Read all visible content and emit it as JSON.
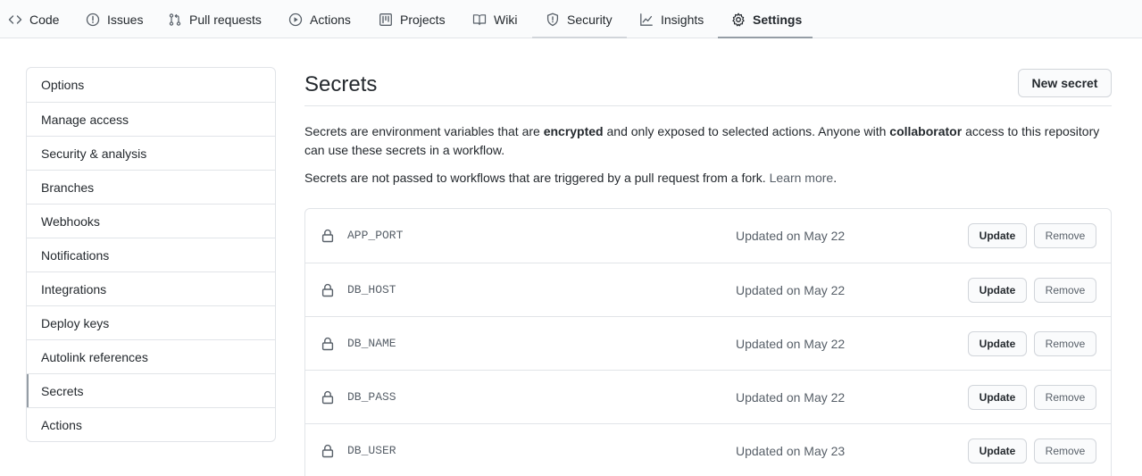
{
  "repo_nav": {
    "tabs": [
      {
        "label": "Code",
        "icon": "code-icon"
      },
      {
        "label": "Issues",
        "icon": "issue-opened-icon"
      },
      {
        "label": "Pull requests",
        "icon": "git-pull-request-icon"
      },
      {
        "label": "Actions",
        "icon": "play-icon"
      },
      {
        "label": "Projects",
        "icon": "project-icon"
      },
      {
        "label": "Wiki",
        "icon": "book-icon"
      },
      {
        "label": "Security",
        "icon": "shield-icon"
      },
      {
        "label": "Insights",
        "icon": "graph-icon"
      },
      {
        "label": "Settings",
        "icon": "gear-icon"
      }
    ],
    "selected": "Settings"
  },
  "sidebar": {
    "items": [
      {
        "label": "Options"
      },
      {
        "label": "Manage access"
      },
      {
        "label": "Security & analysis"
      },
      {
        "label": "Branches"
      },
      {
        "label": "Webhooks"
      },
      {
        "label": "Notifications"
      },
      {
        "label": "Integrations"
      },
      {
        "label": "Deploy keys"
      },
      {
        "label": "Autolink references"
      },
      {
        "label": "Secrets"
      },
      {
        "label": "Actions"
      }
    ],
    "selected": "Secrets"
  },
  "main": {
    "title": "Secrets",
    "new_secret_label": "New secret",
    "description": {
      "part1": "Secrets are environment variables that are ",
      "bold1": "encrypted",
      "part2": " and only exposed to selected actions. Anyone with ",
      "bold2": "collaborator",
      "part3": " access to this repository can use these secrets in a workflow."
    },
    "fork_note": {
      "text": "Secrets are not passed to workflows that are triggered by a pull request from a fork. ",
      "link": "Learn more",
      "end": "."
    },
    "secrets": [
      {
        "name": "APP_PORT",
        "updated": "Updated on May 22"
      },
      {
        "name": "DB_HOST",
        "updated": "Updated on May 22"
      },
      {
        "name": "DB_NAME",
        "updated": "Updated on May 22"
      },
      {
        "name": "DB_PASS",
        "updated": "Updated on May 22"
      },
      {
        "name": "DB_USER",
        "updated": "Updated on May 23"
      }
    ],
    "update_label": "Update",
    "remove_label": "Remove"
  },
  "colors": {
    "text": "#24292e",
    "muted": "#586069",
    "border": "#e1e4e8",
    "button_bg": "#fafbfc"
  }
}
